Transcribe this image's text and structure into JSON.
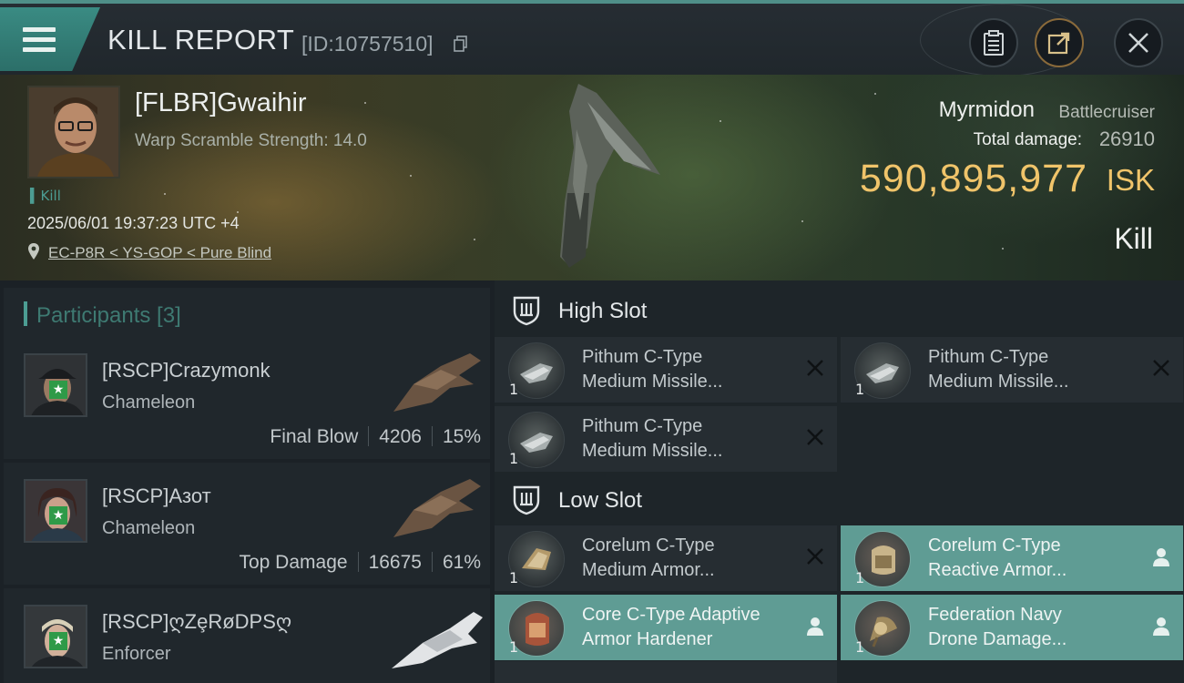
{
  "header": {
    "title": "KILL REPORT",
    "report_id": "[ID:10757510]"
  },
  "victim": {
    "name": "[FLBR]Gwaihir",
    "warp_scramble": "Warp Scramble Strength: 14.0",
    "kill_tag": "Kill",
    "datetime": "2025/06/01 19:37:23 UTC +4",
    "location": "EC-P8R < YS-GOP < Pure Blind",
    "ship_name": "Myrmidon",
    "ship_class": "Battlecruiser",
    "total_damage_label": "Total damage:",
    "total_damage": "26910",
    "isk_value": "590,895,977",
    "isk_unit": "ISK",
    "result": "Kill"
  },
  "participants": {
    "title": "Participants [3]",
    "items": [
      {
        "name": "[RSCP]Crazymonk",
        "ship": "Chameleon",
        "role": "Final Blow",
        "damage": "4206",
        "percent": "15%"
      },
      {
        "name": "[RSCP]Азот",
        "ship": "Chameleon",
        "role": "Top Damage",
        "damage": "16675",
        "percent": "61%"
      },
      {
        "name": "[RSCP]ღZȩRøDPSღ",
        "ship": "Enforcer",
        "role": "",
        "damage": "",
        "percent": ""
      }
    ]
  },
  "slots": {
    "high": {
      "title": "High Slot",
      "modules": [
        {
          "qty": "1",
          "line1": "Pithum C-Type",
          "line2": "Medium Missile...",
          "status": "destroyed"
        },
        {
          "qty": "1",
          "line1": "Pithum C-Type",
          "line2": "Medium Missile...",
          "status": "destroyed"
        },
        {
          "qty": "1",
          "line1": "Pithum C-Type",
          "line2": "Medium Missile...",
          "status": "destroyed"
        }
      ]
    },
    "low": {
      "title": "Low Slot",
      "modules": [
        {
          "qty": "1",
          "line1": "Corelum C-Type",
          "line2": "Medium Armor...",
          "status": "destroyed"
        },
        {
          "qty": "1",
          "line1": "Corelum C-Type",
          "line2": "Reactive Armor...",
          "status": "dropped"
        },
        {
          "qty": "1",
          "line1": "Core C-Type Adaptive",
          "line2": " Armor Hardener",
          "status": "dropped"
        },
        {
          "qty": "1",
          "line1": "Federation Navy",
          "line2": "Drone Damage...",
          "status": "dropped"
        }
      ]
    }
  },
  "colors": {
    "accent": "#4c9d93",
    "isk": "#f0c46a",
    "dropped_bg": "#5f9c94",
    "destroyed_bg": "#262d32"
  }
}
